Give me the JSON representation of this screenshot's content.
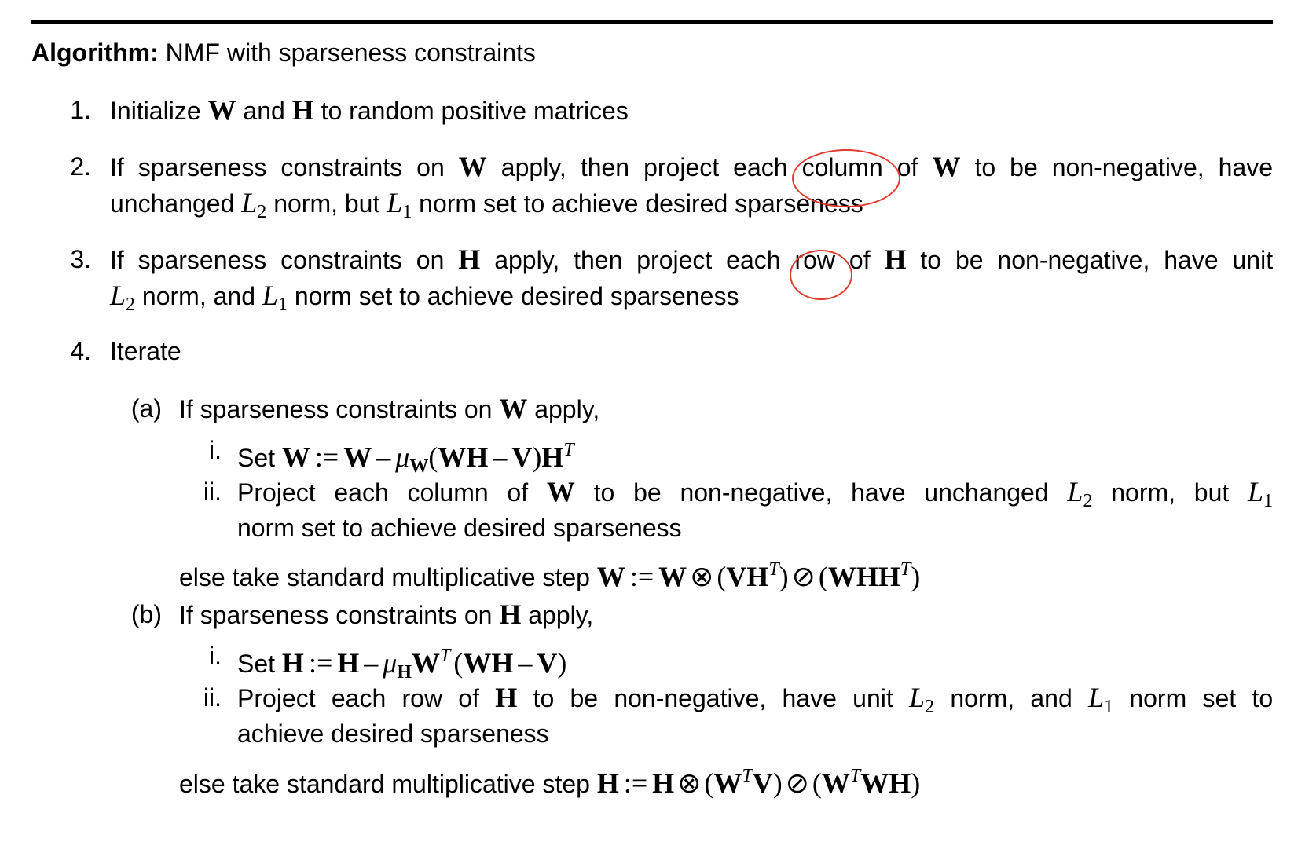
{
  "heading": {
    "label": "Algorithm:",
    "title": "NMF with sparseness constraints"
  },
  "steps": [
    {
      "number": "1.",
      "text": {
        "a": "Initialize",
        "W": "W",
        "b": "and",
        "H": "H",
        "c": "to random positive matrices"
      }
    },
    {
      "number": "2.",
      "line1": {
        "a": "If sparseness constraints on",
        "W": "W",
        "b": "apply, then project each",
        "circled": "column",
        "c": "of",
        "W2": "W",
        "d": "to be non-negative, have"
      },
      "line2": {
        "a": "unchanged",
        "L": "L",
        "sub2": "2",
        "b": "norm, but",
        "L2": "L",
        "sub1": "1",
        "c": "norm set to achieve desired sparseness"
      }
    },
    {
      "number": "3.",
      "line1": {
        "a": "If sparseness constraints on",
        "H": "H",
        "b": "apply, then project each",
        "circled": "row",
        "c": "of",
        "H2": "H",
        "d": "to be non-negative, have unit"
      },
      "line2": {
        "L": "L",
        "sub2": "2",
        "a": "norm, and",
        "L2": "L",
        "sub1": "1",
        "b": "norm set to achieve desired sparseness"
      }
    },
    {
      "number": "4.",
      "text": "Iterate"
    }
  ],
  "substeps": {
    "a": {
      "label": "(a)",
      "cond": {
        "a": "If sparseness constraints on",
        "W": "W",
        "b": "apply,"
      },
      "i": {
        "label": "i.",
        "set": "Set",
        "lhs": "W",
        "assign": ":=",
        "w": "W",
        "minus": "–",
        "mu": "μ",
        "musub": "W",
        "lp": "(",
        "wh": "WH",
        "minus2": "–",
        "v": "V",
        "rp": ")",
        "h": "H",
        "t": "T"
      },
      "ii": {
        "label": "ii.",
        "line1": {
          "a": "Project each column of",
          "W": "W",
          "b": "to be non-negative, have unchanged",
          "L": "L",
          "sub2": "2",
          "c": "norm, but",
          "L2": "L",
          "sub1": "1"
        },
        "line2": "norm set to achieve desired sparseness"
      },
      "else": {
        "text": "else take standard multiplicative step",
        "lhs": "W",
        "assign": ":=",
        "w": "W",
        "otimes": "⊗",
        "lp": "(",
        "vh": "VH",
        "t": "T",
        "rp": ")",
        "oslash": "⊘",
        "lp2": "(",
        "whh": "WHH",
        "t2": "T",
        "rp2": ")"
      }
    },
    "b": {
      "label": "(b)",
      "cond": {
        "a": "If sparseness constraints on",
        "H": "H",
        "b": "apply,"
      },
      "i": {
        "label": "i.",
        "set": "Set",
        "lhs": "H",
        "assign": ":=",
        "h": "H",
        "minus": "–",
        "mu": "μ",
        "musub": "H",
        "w": "W",
        "t": "T",
        "lp": "(",
        "wh": "WH",
        "minus2": "–",
        "v": "V",
        "rp": ")"
      },
      "ii": {
        "label": "ii.",
        "line1": {
          "a": "Project each row of",
          "H": "H",
          "b": "to be non-negative, have unit",
          "L": "L",
          "sub2": "2",
          "c": "norm, and",
          "L2": "L",
          "sub1": "1",
          "d": "norm set to"
        },
        "line2": "achieve desired sparseness"
      },
      "else": {
        "text": "else take standard multiplicative step",
        "lhs": "H",
        "assign": ":=",
        "h": "H",
        "otimes": "⊗",
        "lp": "(",
        "w": "W",
        "t": "T",
        "v": "V",
        "rp": ")",
        "oslash": "⊘",
        "lp2": "(",
        "w2": "W",
        "t2": "T",
        "wh": "WH",
        "rp2": ")"
      }
    }
  },
  "colors": {
    "annotation": "#e23b2e"
  }
}
